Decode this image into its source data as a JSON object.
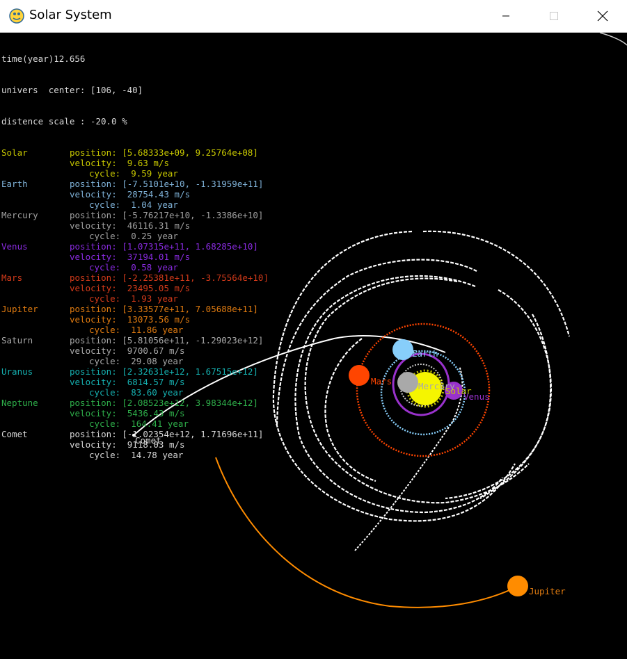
{
  "window": {
    "title": "Solar System"
  },
  "hud": {
    "time": "time(year)12.656",
    "center": "univers  center: [106, -40]",
    "scale": "distence scale : -20.0 %"
  },
  "bodies": [
    {
      "name": "Solar",
      "color": "#c8c800",
      "position": "position: [5.68333e+09, 9.25764e+08]",
      "velocity": "velocity:  9.63 m/s",
      "cycle": "cycle:  9.59 year"
    },
    {
      "name": "Earth",
      "color": "#7fb2d8",
      "position": "position: [-7.5101e+10, -1.31959e+11]",
      "velocity": "velocity:  28754.43 m/s",
      "cycle": "cycle:  1.04 year"
    },
    {
      "name": "Mercury",
      "color": "#a0a0a0",
      "position": "position: [-5.76217e+10, -1.3386e+10]",
      "velocity": "velocity:  46116.31 m/s",
      "cycle": "cycle:  0.25 year"
    },
    {
      "name": "Venus",
      "color": "#8a2be2",
      "position": "position: [1.07315e+11, 1.68285e+10]",
      "velocity": "velocity:  37194.01 m/s",
      "cycle": "cycle:  0.58 year"
    },
    {
      "name": "Mars",
      "color": "#d33a1a",
      "position": "position: [-2.25381e+11, -3.75564e+10]",
      "velocity": "velocity:  23495.05 m/s",
      "cycle": "cycle:  1.93 year"
    },
    {
      "name": "Jupiter",
      "color": "#e07b10",
      "position": "position: [3.33577e+11, 7.05688e+11]",
      "velocity": "velocity:  13073.56 m/s",
      "cycle": "cycle:  11.86 year"
    },
    {
      "name": "Saturn",
      "color": "#a8a8a8",
      "position": "position: [5.81056e+11, -1.29023e+12]",
      "velocity": "velocity:  9700.67 m/s",
      "cycle": "cycle:  29.08 year"
    },
    {
      "name": "Uranus",
      "color": "#15b0b0",
      "position": "position: [2.32631e+12, 1.67515e+12]",
      "velocity": "velocity:  6814.57 m/s",
      "cycle": "cycle:  83.60 year"
    },
    {
      "name": "Neptune",
      "color": "#2eaf4a",
      "position": "position: [2.08523e+12, 3.98344e+12]",
      "velocity": "velocity:  5436.43 m/s",
      "cycle": "cycle:  164.41 year"
    },
    {
      "name": "Comet",
      "color": "#d8d8d8",
      "position": "position: [-1.02354e+12, 1.71696e+11]",
      "velocity": "velocity:  9118.03 m/s",
      "cycle": "cycle:  14.78 year"
    }
  ],
  "labels": {
    "earth": "Earth",
    "mars": "Mars",
    "mercury": "Mercury",
    "solar": "Solar",
    "venus": "Venus",
    "comet": "Comet",
    "jupiter": "Jupiter"
  },
  "colors": {
    "sun": "#f5f500",
    "earth": "#87cefa",
    "mercury": "#a9a9a9",
    "venus": "#9932cc",
    "mars": "#ff4500",
    "jupiter": "#ff8c00",
    "trail": "#ffffff"
  }
}
